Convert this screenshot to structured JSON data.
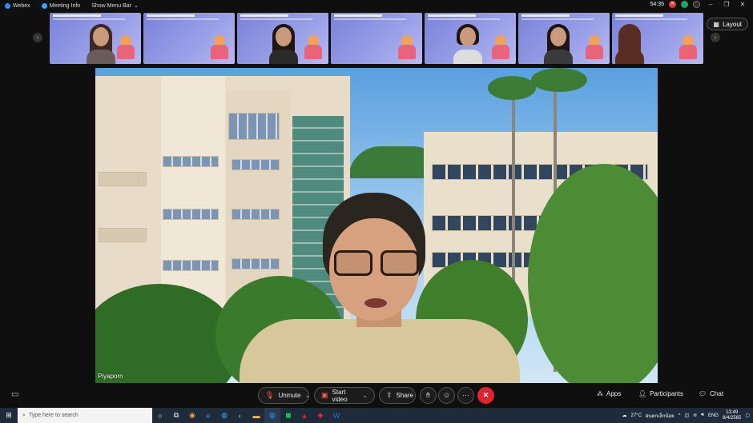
{
  "titlebar": {
    "app_name": "Webex",
    "meeting_info": "Meeting Info",
    "show_menu_bar": "Show Menu Bar",
    "timer": "54:35"
  },
  "layout_button": "Layout",
  "filmstrip_count": 7,
  "speaker_name": "Piyaporn",
  "controls": {
    "unmute": "Unmute",
    "start_video": "Start video",
    "share": "Share",
    "more": "···",
    "end": "✕"
  },
  "right_controls": {
    "apps": "Apps",
    "participants": "Participants",
    "chat": "Chat"
  },
  "taskbar": {
    "search_placeholder": "Type here to search",
    "weather": "27°C",
    "weather_desc": "ฝนตกเล็กน้อย",
    "lang": "ENG",
    "time": "13:49",
    "date": "8/4/2565"
  }
}
